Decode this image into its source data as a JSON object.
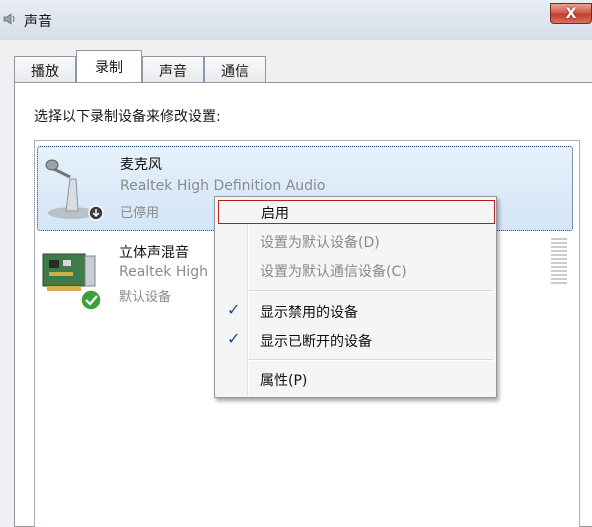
{
  "window": {
    "title": "声音",
    "close_label": "X"
  },
  "tabs": [
    {
      "label": "播放"
    },
    {
      "label": "录制"
    },
    {
      "label": "声音"
    },
    {
      "label": "通信"
    }
  ],
  "instruction": "选择以下录制设备来修改设置:",
  "devices": [
    {
      "name": "麦克风",
      "description": "Realtek High Definition Audio",
      "status": "已停用",
      "icon": "microphone-icon",
      "state": "disabled"
    },
    {
      "name": "立体声混音",
      "description": "Realtek High",
      "status": "默认设备",
      "icon": "sound-card-icon",
      "state": "default"
    }
  ],
  "context_menu": {
    "items": [
      {
        "label": "启用",
        "enabled": true,
        "checked": false
      },
      {
        "label": "设置为默认设备(D)",
        "enabled": false,
        "checked": false
      },
      {
        "label": "设置为默认通信设备(C)",
        "enabled": false,
        "checked": false
      },
      {
        "label": "显示禁用的设备",
        "enabled": true,
        "checked": true
      },
      {
        "label": "显示已断开的设备",
        "enabled": true,
        "checked": true
      },
      {
        "label": "属性(P)",
        "enabled": true,
        "checked": false
      }
    ]
  },
  "colors": {
    "selection": "#d3e5f6",
    "highlight_border": "#b51f1f",
    "check": "#1f4f8f",
    "close": "#c23c2a",
    "default_badge": "#3aa03a"
  }
}
